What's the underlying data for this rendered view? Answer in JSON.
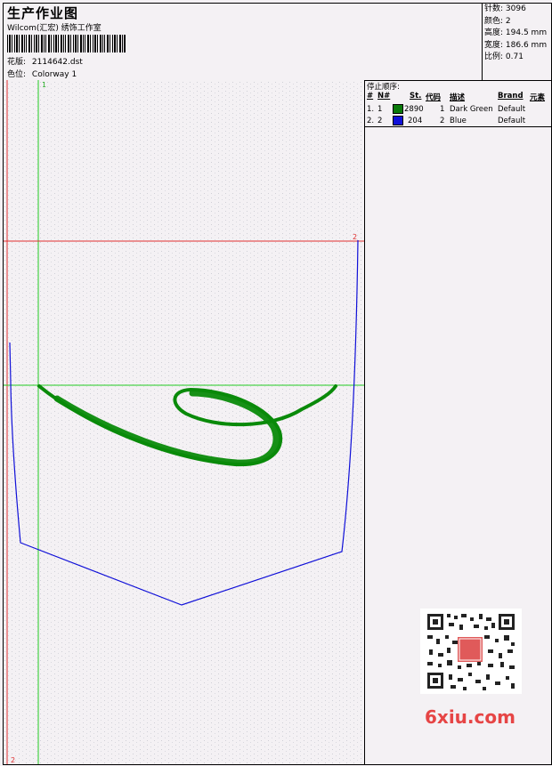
{
  "header": {
    "title": "生产作业图",
    "studio": "Wilcom(汇宏) 绣饰工作室",
    "design_label": "花版:",
    "design_value": "2114642.dst",
    "colorway_label": "色位:",
    "colorway_value": "Colorway 1"
  },
  "stats": [
    {
      "label": "针数:",
      "value": "3096"
    },
    {
      "label": "颜色:",
      "value": "2"
    },
    {
      "label": "高度:",
      "value": "194.5 mm"
    },
    {
      "label": "宽度:",
      "value": "186.6 mm"
    },
    {
      "label": "比例:",
      "value": "0.71"
    }
  ],
  "stop_sequence": {
    "label": "停止顺序:",
    "columns": [
      "#",
      "N#",
      "St.",
      "代码",
      "描述",
      "Brand",
      "元素"
    ],
    "rows": [
      {
        "index": "1.",
        "n": "1",
        "stitches": "2890",
        "code": "1",
        "description": "Dark Green",
        "brand": "Default",
        "color": "#0a7a0a"
      },
      {
        "index": "2.",
        "n": "2",
        "stitches": "204",
        "code": "2",
        "description": "Blue",
        "brand": "Default",
        "color": "#1010d8"
      }
    ]
  },
  "canvas": {
    "marker_top": "1",
    "marker_right": "2",
    "marker_bottom": "2"
  },
  "watermark": "6xiu.com",
  "qr_badge": "设计图"
}
